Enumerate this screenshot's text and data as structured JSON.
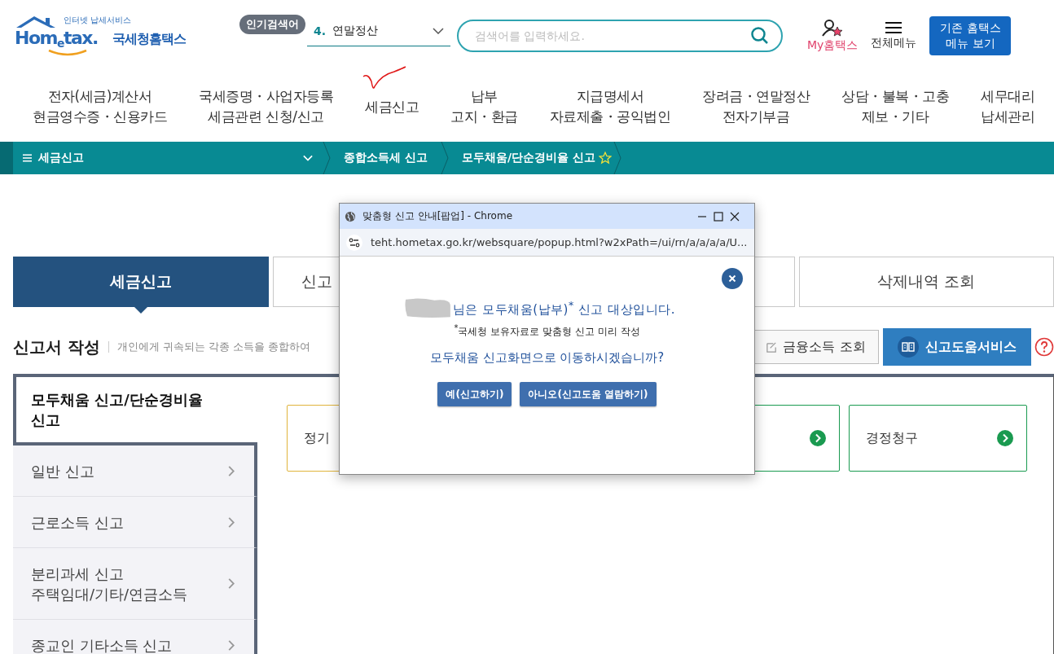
{
  "header": {
    "logo": {
      "tagline": "인터넷 납세서비스",
      "word": "Hom$_{e}$tax.",
      "name": "국세청홈택스"
    },
    "popular": {
      "badge": "인기검색어",
      "rank": "4.",
      "term": "연말정산"
    },
    "search": {
      "placeholder": "검색어를 입력하세요."
    },
    "my": "My홈택스",
    "all_menu": "전체메뉴",
    "legacy_button": "기존 홈택스\n메뉴 보기"
  },
  "nav": [
    {
      "label": "전자(세금)계산서\n현금영수증・신용카드"
    },
    {
      "label": "국세증명・사업자등록\n세금관련 신청/신고"
    },
    {
      "label": "세금신고"
    },
    {
      "label": "납부\n고지・환급"
    },
    {
      "label": "지급명세서\n자료제출・공익법인"
    },
    {
      "label": "장려금・연말정산\n전자기부금"
    },
    {
      "label": "상담・불복・고충\n제보・기타"
    },
    {
      "label": "세무대리\n납세관리"
    }
  ],
  "breadcrumb": {
    "menu": "세금신고",
    "items": [
      "종합소득세 신고",
      "모두채움/단순경비율 신고"
    ]
  },
  "tabs": [
    {
      "label": "세금신고",
      "selected": true
    },
    {
      "label": "신고",
      "selected": false
    },
    {
      "label": "삭제내역 조회",
      "selected": false
    }
  ],
  "section": {
    "title": "신고서 작성",
    "description": "개인에게 귀속되는 각종 소득을 종합하여",
    "buttons": [
      "금융소득 조회",
      "신고도움서비스"
    ]
  },
  "sidebar": {
    "items": [
      {
        "label": "모두채움 신고/단순경비율\n신고",
        "selected": true
      },
      {
        "label": "일반 신고",
        "selected": false
      },
      {
        "label": "근로소득 신고",
        "selected": false
      },
      {
        "label": "분리과세 신고\n주택임대/기타/연금소득",
        "selected": false
      },
      {
        "label": "종교인 기타소득 신고",
        "selected": false
      }
    ]
  },
  "cards": [
    {
      "kind": "text",
      "label": "정기",
      "color": "#e0b43c"
    },
    {
      "kind": "arrow",
      "color": "#1a9a50"
    },
    {
      "kind": "arrow",
      "label": "경정청구",
      "color": "#1a9a50"
    }
  ],
  "popup": {
    "window_title": "맞춤형 신고 안내[팝업] - Chrome",
    "url": "teht.hometax.go.kr/websquare/popup.html?w2xPath=/ui/rn/a/a/a/a/U...",
    "message": "님은 모두채움(납부)$^{*}$ 신고 대상입니다.",
    "note": "$^{*}$국세청 보유자료로 맞춤형 신고 미리 작성",
    "question": "모두채움 신고화면으로 이동하시겠습니까?",
    "buttons": [
      "예(신고하기)",
      "아니오(신고도움 열람하기)"
    ]
  }
}
